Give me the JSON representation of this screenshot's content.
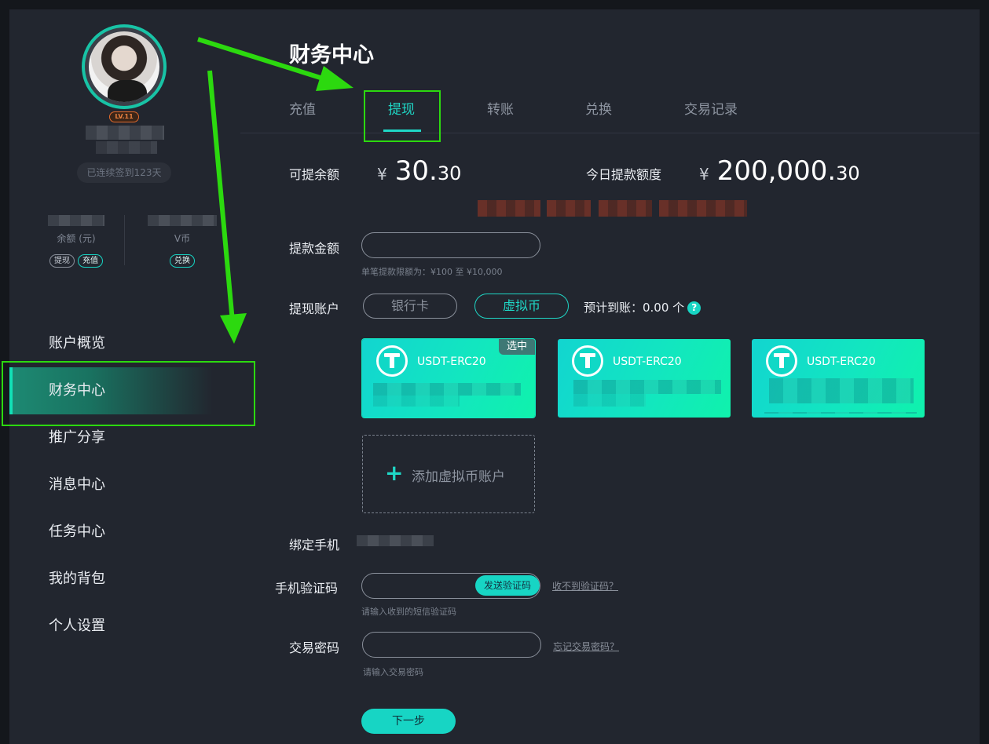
{
  "sidebar": {
    "level": "LV.11",
    "signin_text": "已连续签到123天",
    "balance_label": "余额 (元)",
    "withdraw_tag": "提现",
    "recharge_tag": "充值",
    "vcoin_label": "V币",
    "exchange_tag": "兑换",
    "nav": [
      "账户概览",
      "财务中心",
      "推广分享",
      "消息中心",
      "任务中心",
      "我的背包",
      "个人设置"
    ],
    "active_nav": "财务中心"
  },
  "main": {
    "title": "财务中心",
    "tabs": [
      "充值",
      "提现",
      "转账",
      "兑换",
      "交易记录"
    ],
    "active_tab": "提现",
    "withdrawable": {
      "label": "可提余额",
      "currency": "¥",
      "int": "30.",
      "dec": "30"
    },
    "daily_quota": {
      "label": "今日提款额度",
      "currency": "¥",
      "int": "200,000.",
      "dec": "30"
    },
    "amount_field": {
      "label": "提款金额",
      "hint": "单笔提款限额为：¥100 至 ¥10,000"
    },
    "account": {
      "label": "提现账户",
      "options": [
        "银行卡",
        "虚拟币"
      ],
      "selected": "虚拟币",
      "estimate": "预计到账：0.00 个",
      "help_icon": "?"
    },
    "cards": [
      {
        "name": "USDT-ERC20",
        "selected_tag": "选中"
      },
      {
        "name": "USDT-ERC20"
      },
      {
        "name": "USDT-ERC20"
      }
    ],
    "add_account": {
      "plus": "+",
      "label": "添加虚拟币账户"
    },
    "phone": {
      "label": "绑定手机"
    },
    "sms": {
      "label": "手机验证码",
      "send_button": "发送验证码",
      "link": "收不到验证码？",
      "hint": "请输入收到的短信验证码"
    },
    "trade_password": {
      "label": "交易密码",
      "link": "忘记交易密码？",
      "hint": "请输入交易密码"
    },
    "next_button": "下一步"
  },
  "colors": {
    "accent": "#1fd7c6",
    "highlight_box": "#2cd90f",
    "panel": "#22262f"
  }
}
